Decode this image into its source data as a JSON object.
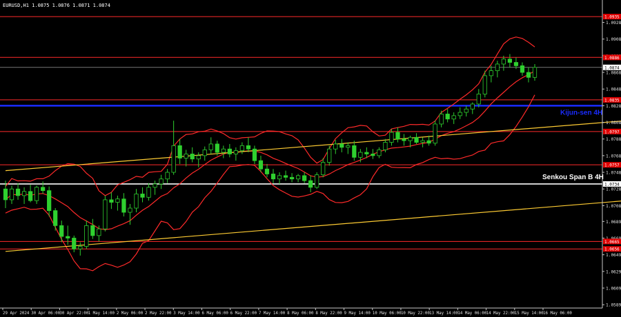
{
  "header": {
    "title": "EURUSD,H1  1.0875 1.0876 1.0871 1.0874"
  },
  "chart_data": {
    "type": "candlestick",
    "symbol": "EURUSD",
    "timeframe": "H1",
    "ylim": [
      1.0585,
      1.0945
    ],
    "y_ticks": [
      "1.0928",
      "1.0908",
      "1.0888",
      "1.0868",
      "1.0848",
      "1.0828",
      "1.0808",
      "1.0788",
      "1.0768",
      "1.0748",
      "1.0728",
      "1.0708",
      "1.0689",
      "1.0669",
      "1.0649",
      "1.0629",
      "1.0609",
      "1.0589"
    ],
    "x_ticks": [
      "29 Apr 2024",
      "30 Apr 06:00",
      "30 Apr 22:00",
      "1 May 14:00",
      "2 May 06:00",
      "2 May 22:00",
      "3 May 14:00",
      "6 May 06:00",
      "6 May 22:00",
      "7 May 14:00",
      "8 May 06:00",
      "8 May 22:00",
      "9 May 14:00",
      "10 May 06:00",
      "10 May 22:00",
      "13 May 14:00",
      "14 May 06:00",
      "14 May 22:00",
      "15 May 14:00",
      "16 May 06:00"
    ],
    "current_price": 1.0874,
    "current_price_label": "1.0874",
    "horizontal_levels": [
      {
        "price": 1.0935,
        "label": "1.0935",
        "color": "#ff2a2a"
      },
      {
        "price": 1.0886,
        "label": "1.0886",
        "color": "#ff2a2a"
      },
      {
        "price": 1.0835,
        "label": "1.0835",
        "color": "#ff2a2a"
      },
      {
        "price": 1.0797,
        "label": "1.0797",
        "color": "#ff2a2a"
      },
      {
        "price": 1.0757,
        "label": "1.0757",
        "color": "#ff2a2a"
      },
      {
        "price": 1.0734,
        "label": "1.0734",
        "color": "#ffffff"
      },
      {
        "price": 1.0665,
        "label": "1.0665",
        "color": "#ff2a2a"
      },
      {
        "price": 1.0656,
        "label": "1.0656",
        "color": "#ff2a2a"
      }
    ],
    "kijun": {
      "price": 1.0828,
      "label": "Kijun-sen 4H",
      "color": "#1a2cff"
    },
    "senkou": {
      "price": 1.0734,
      "label": "Senkou Span B 4H",
      "color": "#ffffff"
    },
    "channel_color": "#ffcc33",
    "channel_upper": [
      [
        0,
        1.075
      ],
      [
        103,
        1.081
      ]
    ],
    "channel_lower": [
      [
        0,
        1.0653
      ],
      [
        103,
        1.0714
      ]
    ],
    "candles": [
      [
        1.0728,
        1.0738,
        1.0705,
        1.0715
      ],
      [
        1.0715,
        1.0732,
        1.071,
        1.0728
      ],
      [
        1.0728,
        1.0735,
        1.0715,
        1.072
      ],
      [
        1.072,
        1.073,
        1.071,
        1.0725
      ],
      [
        1.0725,
        1.0733,
        1.0712,
        1.0714
      ],
      [
        1.0714,
        1.0732,
        1.071,
        1.073
      ],
      [
        1.073,
        1.0737,
        1.0722,
        1.0726
      ],
      [
        1.0726,
        1.0731,
        1.0695,
        1.0702
      ],
      [
        1.0702,
        1.0705,
        1.0678,
        1.0684
      ],
      [
        1.0684,
        1.069,
        1.0664,
        1.0671
      ],
      [
        1.0671,
        1.0684,
        1.0661,
        1.0669
      ],
      [
        1.0669,
        1.0672,
        1.0652,
        1.0656
      ],
      [
        1.0656,
        1.0664,
        1.0648,
        1.0659
      ],
      [
        1.0659,
        1.069,
        1.0656,
        1.0684
      ],
      [
        1.0684,
        1.0692,
        1.0668,
        1.0672
      ],
      [
        1.0672,
        1.0684,
        1.0665,
        1.068
      ],
      [
        1.068,
        1.072,
        1.0677,
        1.0715
      ],
      [
        1.0715,
        1.0724,
        1.0704,
        1.0712
      ],
      [
        1.0712,
        1.072,
        1.0702,
        1.0716
      ],
      [
        1.0716,
        1.0723,
        1.0695,
        1.07
      ],
      [
        1.07,
        1.071,
        1.0685,
        1.0705
      ],
      [
        1.0705,
        1.0728,
        1.07,
        1.0722
      ],
      [
        1.0722,
        1.073,
        1.0712,
        1.0718
      ],
      [
        1.0718,
        1.0735,
        1.0714,
        1.073
      ],
      [
        1.073,
        1.0738,
        1.0721,
        1.0734
      ],
      [
        1.0734,
        1.0745,
        1.0728,
        1.074
      ],
      [
        1.074,
        1.0752,
        1.0735,
        1.0748
      ],
      [
        1.0748,
        1.081,
        1.0745,
        1.078
      ],
      [
        1.078,
        1.0788,
        1.0758,
        1.0765
      ],
      [
        1.0765,
        1.0775,
        1.0755,
        1.077
      ],
      [
        1.077,
        1.0778,
        1.076,
        1.0764
      ],
      [
        1.0764,
        1.0772,
        1.0754,
        1.0768
      ],
      [
        1.0768,
        1.0779,
        1.0762,
        1.0775
      ],
      [
        1.0775,
        1.079,
        1.077,
        1.0782
      ],
      [
        1.0782,
        1.0786,
        1.0768,
        1.0772
      ],
      [
        1.0772,
        1.078,
        1.0765,
        1.0776
      ],
      [
        1.0776,
        1.0782,
        1.0766,
        1.077
      ],
      [
        1.077,
        1.0778,
        1.0762,
        1.0774
      ],
      [
        1.0774,
        1.0784,
        1.077,
        1.078
      ],
      [
        1.078,
        1.079,
        1.0772,
        1.0776
      ],
      [
        1.0776,
        1.078,
        1.0758,
        1.0762
      ],
      [
        1.0762,
        1.0768,
        1.0748,
        1.0752
      ],
      [
        1.0752,
        1.0758,
        1.0742,
        1.0746
      ],
      [
        1.0746,
        1.0752,
        1.0735,
        1.074
      ],
      [
        1.074,
        1.0748,
        1.0734,
        1.0744
      ],
      [
        1.0744,
        1.075,
        1.0738,
        1.0742
      ],
      [
        1.0742,
        1.0747,
        1.0736,
        1.074
      ],
      [
        1.074,
        1.0746,
        1.0736,
        1.0744
      ],
      [
        1.0744,
        1.0748,
        1.0735,
        1.0738
      ],
      [
        1.0738,
        1.0744,
        1.0724,
        1.073
      ],
      [
        1.073,
        1.0748,
        1.0728,
        1.0745
      ],
      [
        1.0745,
        1.0765,
        1.0742,
        1.076
      ],
      [
        1.076,
        1.078,
        1.0756,
        1.0776
      ],
      [
        1.0776,
        1.0787,
        1.077,
        1.0782
      ],
      [
        1.0782,
        1.0788,
        1.0772,
        1.0778
      ],
      [
        1.0778,
        1.0784,
        1.077,
        1.078
      ],
      [
        1.078,
        1.0786,
        1.0762,
        1.0766
      ],
      [
        1.0766,
        1.0776,
        1.076,
        1.0772
      ],
      [
        1.0772,
        1.0778,
        1.0765,
        1.077
      ],
      [
        1.077,
        1.0776,
        1.0764,
        1.0768
      ],
      [
        1.0768,
        1.0778,
        1.0765,
        1.0775
      ],
      [
        1.0775,
        1.0788,
        1.0772,
        1.0784
      ],
      [
        1.0784,
        1.08,
        1.078,
        1.0796
      ],
      [
        1.0796,
        1.0802,
        1.0784,
        1.0788
      ],
      [
        1.0788,
        1.0794,
        1.078,
        1.0786
      ],
      [
        1.0786,
        1.0792,
        1.0778,
        1.079
      ],
      [
        1.079,
        1.0795,
        1.0782,
        1.0784
      ],
      [
        1.0784,
        1.079,
        1.0778,
        1.0786
      ],
      [
        1.0786,
        1.0792,
        1.078,
        1.0783
      ],
      [
        1.0783,
        1.081,
        1.078,
        1.0806
      ],
      [
        1.0806,
        1.0822,
        1.0802,
        1.0818
      ],
      [
        1.0818,
        1.0824,
        1.0808,
        1.0812
      ],
      [
        1.0812,
        1.082,
        1.0806,
        1.0816
      ],
      [
        1.0816,
        1.0826,
        1.0812,
        1.082
      ],
      [
        1.082,
        1.0828,
        1.0815,
        1.0824
      ],
      [
        1.0824,
        1.0832,
        1.0818,
        1.083
      ],
      [
        1.083,
        1.0848,
        1.0826,
        1.0842
      ],
      [
        1.0842,
        1.087,
        1.0838,
        1.0864
      ],
      [
        1.0864,
        1.0876,
        1.0856,
        1.087
      ],
      [
        1.087,
        1.0882,
        1.0862,
        1.0878
      ],
      [
        1.0878,
        1.0888,
        1.087,
        1.0884
      ],
      [
        1.0884,
        1.089,
        1.0874,
        1.088
      ],
      [
        1.088,
        1.0886,
        1.0872,
        1.0876
      ],
      [
        1.0876,
        1.088,
        1.0864,
        1.0868
      ],
      [
        1.0868,
        1.0874,
        1.0856,
        1.0862
      ],
      [
        1.0862,
        1.0878,
        1.0858,
        1.0874
      ]
    ],
    "bollinger_color": "#ff2a2a"
  }
}
